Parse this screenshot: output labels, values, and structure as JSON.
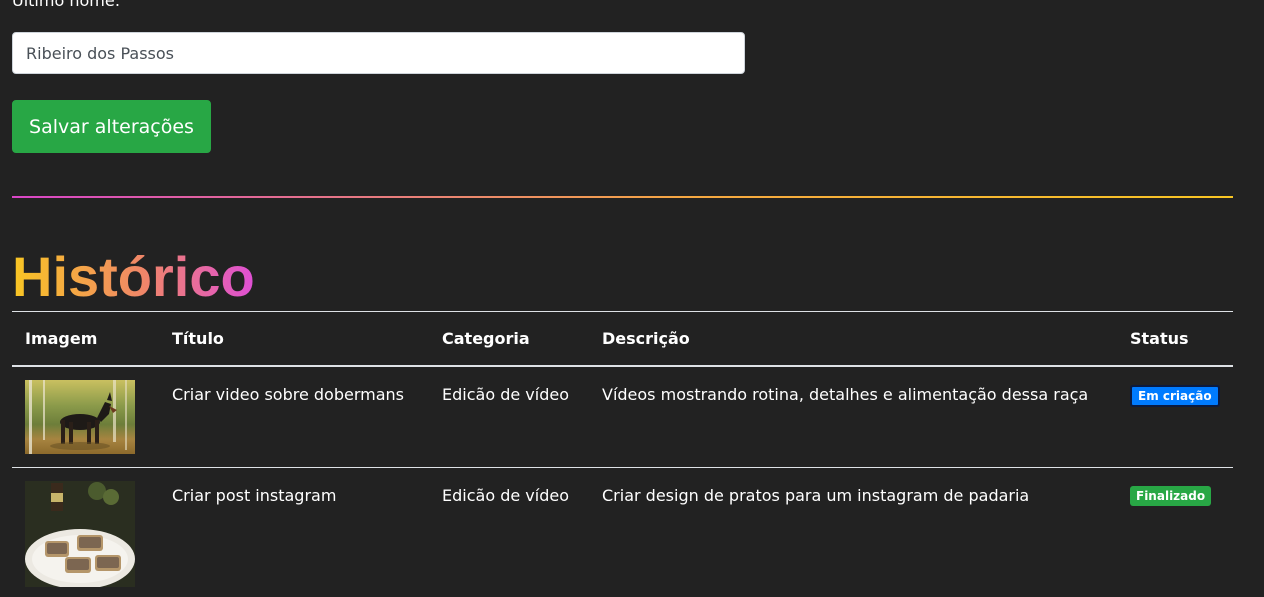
{
  "form": {
    "last_name_label": "Último nome:",
    "last_name_value": "Ribeiro dos Passos",
    "save_label": "Salvar alterações"
  },
  "history": {
    "title": "Histórico",
    "columns": {
      "image": "Imagem",
      "title": "Título",
      "category": "Categoria",
      "description": "Descrição",
      "status": "Status"
    },
    "rows": [
      {
        "image": "doberman-photo",
        "title": "Criar video sobre dobermans",
        "category": "Edicão de vídeo",
        "description": "Vídeos mostrando rotina, detalhes e alimentação dessa raça",
        "status": "Em criação",
        "status_color": "#007bff"
      },
      {
        "image": "bread-plate-photo",
        "title": "Criar post instagram",
        "category": "Edicão de vídeo",
        "description": "Criar design de pratos para um instagram de padaria",
        "status": "Finalizado",
        "status_color": "#28a745"
      }
    ]
  },
  "colors": {
    "background": "#222222",
    "save_button": "#28a745",
    "gradient_start": "#f9c623",
    "gradient_end": "#df4fd6"
  }
}
